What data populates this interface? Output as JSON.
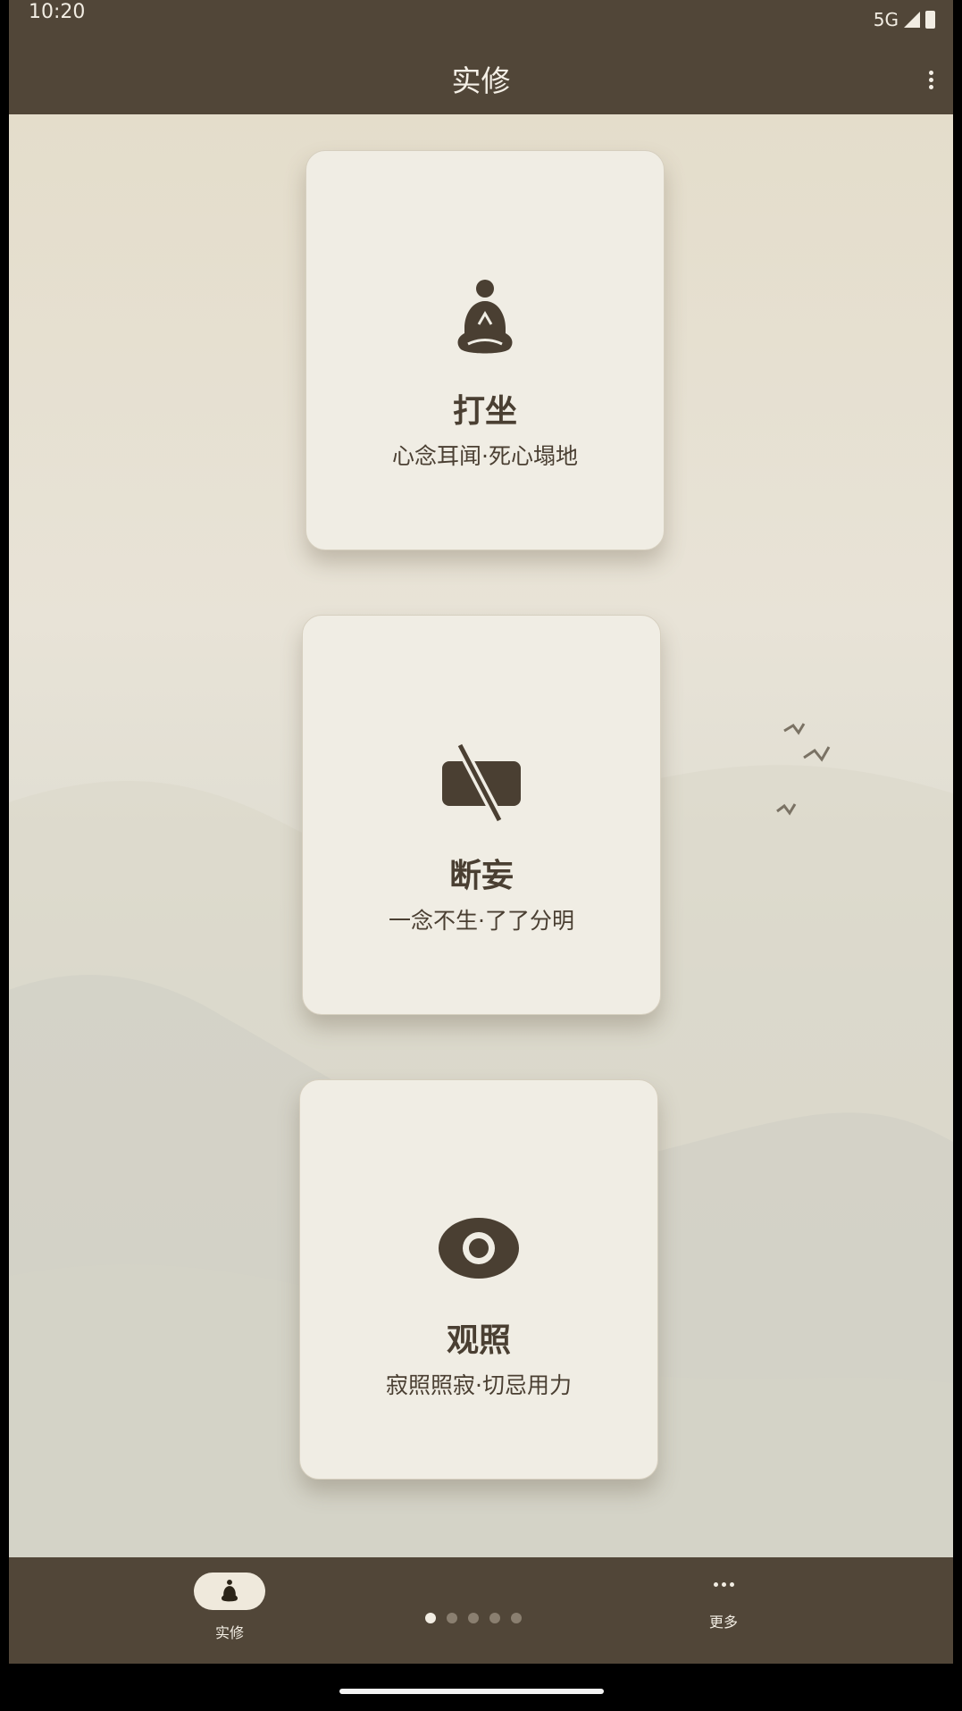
{
  "status_bar": {
    "time": "10:20",
    "network": "5G"
  },
  "app_bar": {
    "title": "实修"
  },
  "cards": [
    {
      "icon": "meditation-icon",
      "title": "打坐",
      "subtitle": "心念耳闻·死心塌地"
    },
    {
      "icon": "no-screen-icon",
      "title": "断妄",
      "subtitle": "一念不生·了了分明"
    },
    {
      "icon": "eye-icon",
      "title": "观照",
      "subtitle": "寂照照寂·切忌用力"
    }
  ],
  "bottom_nav": {
    "practice_label": "实修",
    "more_label": "更多",
    "page_count": 5,
    "active_page": 1
  },
  "colors": {
    "bar": "#514638",
    "card": "#f0ede4",
    "text": "#4a3f32"
  }
}
